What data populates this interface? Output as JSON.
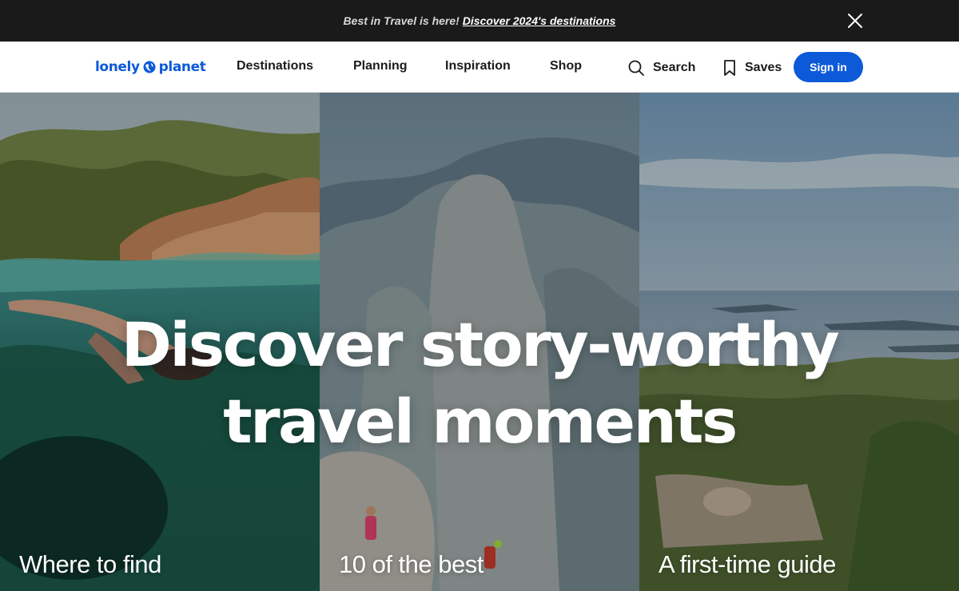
{
  "announcement": {
    "lead": "Best in Travel is here!",
    "link": "Discover 2024's destinations",
    "close_icon": "close-icon"
  },
  "header": {
    "logo": {
      "left": "lonely",
      "right": "planet",
      "icon": "globe-icon"
    },
    "nav": [
      "Destinations",
      "Planning",
      "Inspiration",
      "Shop"
    ],
    "search_label": "Search",
    "search_icon": "search-icon",
    "saves_label": "Saves",
    "saves_icon": "bookmark-icon",
    "signin_label": "Sign in"
  },
  "hero": {
    "title_line1": "Discover story-worthy",
    "title_line2": "travel moments",
    "cards": [
      {
        "title": "Where to find",
        "image": "snorkeler-cove-photo"
      },
      {
        "title": "10 of the best",
        "image": "mountain-hikers-photo"
      },
      {
        "title": "A first-time guide",
        "image": "coastal-overlook-photo"
      }
    ]
  },
  "colors": {
    "accent": "#0d5ad8",
    "announcement_bg": "#1a1a1a",
    "header_bg": "#ffffff",
    "text_dark": "#1b1b1b"
  }
}
